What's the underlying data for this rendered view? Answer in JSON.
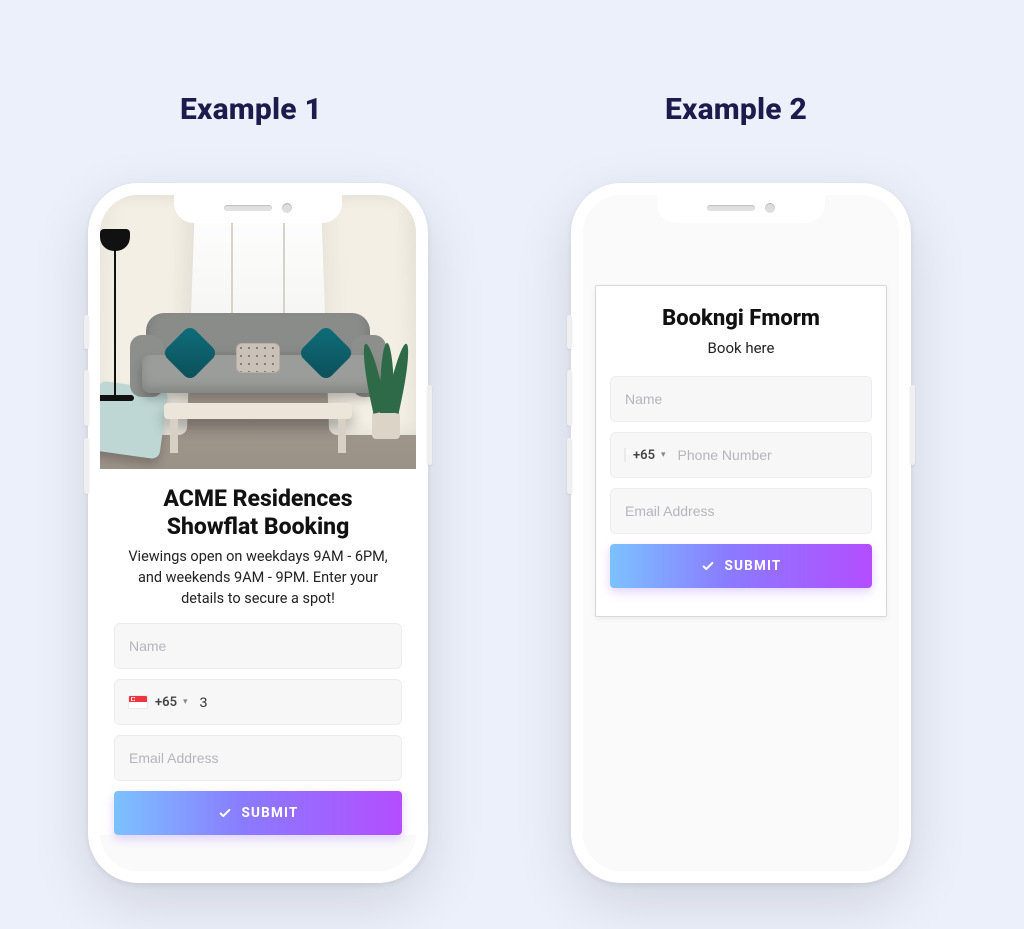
{
  "labels": {
    "example1": "Example 1",
    "example2": "Example 2"
  },
  "phone1": {
    "title_line1": "ACME Residences",
    "title_line2": "Showflat Booking",
    "subtitle": "Viewings open on weekdays 9AM - 6PM, and weekends 9AM - 9PM. Enter your details to secure a spot!",
    "name_placeholder": "Name",
    "name_value": "",
    "country_code": "+65",
    "phone_placeholder": "",
    "phone_value": "3",
    "email_placeholder": "Email Address",
    "email_value": "",
    "submit_label": "SUBMIT"
  },
  "phone2": {
    "title": "Bookngi Fmorm",
    "subtitle": "Book here",
    "name_placeholder": "Name",
    "name_value": "",
    "country_code": "+65",
    "phone_placeholder": "Phone Number",
    "phone_value": "",
    "email_placeholder": "Email Address",
    "email_value": "",
    "submit_label": "SUBMIT"
  }
}
